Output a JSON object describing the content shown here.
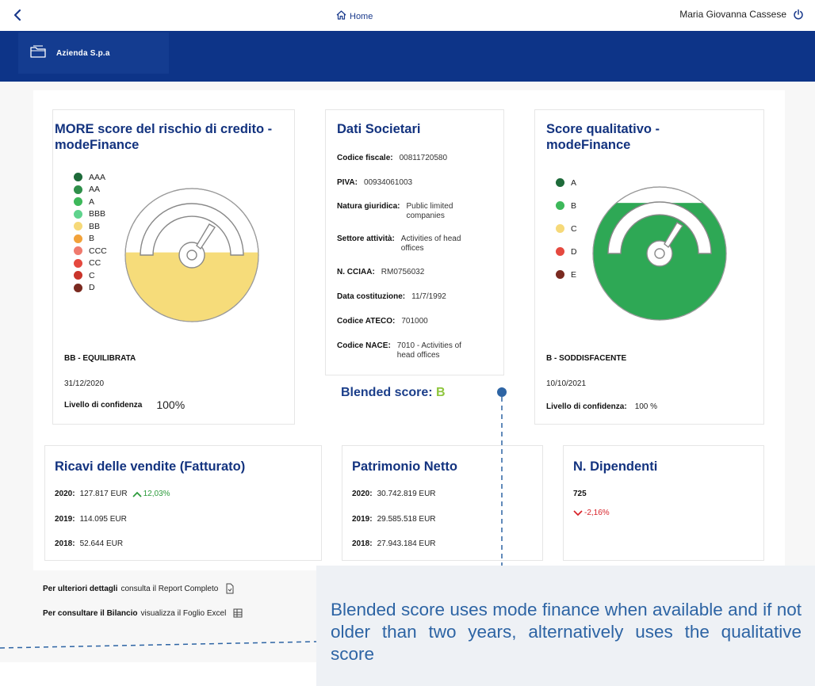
{
  "topbar": {
    "home_label": "Home",
    "user_name": "Maria Giovanna Cassese"
  },
  "brand": {
    "name": "Azienda S.p.a"
  },
  "more_card": {
    "title": "MORE score del rischio di credito - modeFinance",
    "legend": [
      {
        "label": "AAA",
        "color": "#1e6b3a"
      },
      {
        "label": "AA",
        "color": "#2f8f4a"
      },
      {
        "label": "A",
        "color": "#3db85a"
      },
      {
        "label": "BBB",
        "color": "#5fd38d"
      },
      {
        "label": "BB",
        "color": "#f6d979"
      },
      {
        "label": "B",
        "color": "#f2a23a"
      },
      {
        "label": "CCC",
        "color": "#ef7a6e"
      },
      {
        "label": "CC",
        "color": "#e5493f"
      },
      {
        "label": "C",
        "color": "#c9352b"
      },
      {
        "label": "D",
        "color": "#7a2a20"
      }
    ],
    "gauge_fill_color": "#f6dc7a",
    "gauge_fill_level": 0.52,
    "rating": "BB - EQUILIBRATA",
    "date": "31/12/2020",
    "confidence_label": "Livello di confidenza",
    "confidence_value": "100%"
  },
  "dati_card": {
    "title": "Dati Societari",
    "rows": [
      {
        "label": "Codice fiscale:",
        "value": "00811720580"
      },
      {
        "label": "PIVA:",
        "value": "00934061003"
      },
      {
        "label": "Natura giuridica:",
        "value": "Public limited companies"
      },
      {
        "label": "Settore attività:",
        "value": "Activities of head offices"
      },
      {
        "label": "N. CCIAA:",
        "value": "RM0756032"
      },
      {
        "label": "Data costituzione:",
        "value": "11/7/1992"
      },
      {
        "label": "Codice ATECO:",
        "value": "701000"
      },
      {
        "label": "Codice NACE:",
        "value": "7010 - Activities of head offices"
      }
    ]
  },
  "blended": {
    "label": "Blended score",
    "value": "B"
  },
  "qual_card": {
    "title": "Score qualitativo - modeFinance",
    "legend": [
      {
        "label": "A",
        "color": "#1e6b3a"
      },
      {
        "label": "B",
        "color": "#3db85a"
      },
      {
        "label": "C",
        "color": "#f6d979"
      },
      {
        "label": "D",
        "color": "#e5493f"
      },
      {
        "label": "E",
        "color": "#7a2a20"
      }
    ],
    "gauge_fill_color": "#2ea855",
    "gauge_fill_level": 0.88,
    "rating": "B - SODDISFACENTE",
    "date": "10/10/2021",
    "confidence_label": "Livello di confidenza:",
    "confidence_value": "100 %"
  },
  "ricavi_card": {
    "title": "Ricavi delle vendite (Fatturato)",
    "rows": [
      {
        "year": "2020:",
        "value": "127.817 EUR",
        "trend": "12,03%"
      },
      {
        "year": "2019:",
        "value": "114.095 EUR"
      },
      {
        "year": "2018:",
        "value": "52.644 EUR"
      }
    ]
  },
  "patrimonio_card": {
    "title": "Patrimonio Netto",
    "rows": [
      {
        "year": "2020:",
        "value": "30.742.819 EUR"
      },
      {
        "year": "2019:",
        "value": "29.585.518 EUR"
      },
      {
        "year": "2018:",
        "value": "27.943.184 EUR"
      }
    ]
  },
  "dipendenti_card": {
    "title": "N. Dipendenti",
    "count": "725",
    "trend": "-2,16%"
  },
  "footer": {
    "report_bold": "Per ulteriori dettagli",
    "report_text": "consulta il Report Completo",
    "bilancio_bold": "Per consultare il Bilancio",
    "bilancio_text": "visualizza il Foglio Excel"
  },
  "callout": {
    "text": "Blended score uses mode finance when available and if not older than two years, alternatively uses the qualitative score"
  }
}
